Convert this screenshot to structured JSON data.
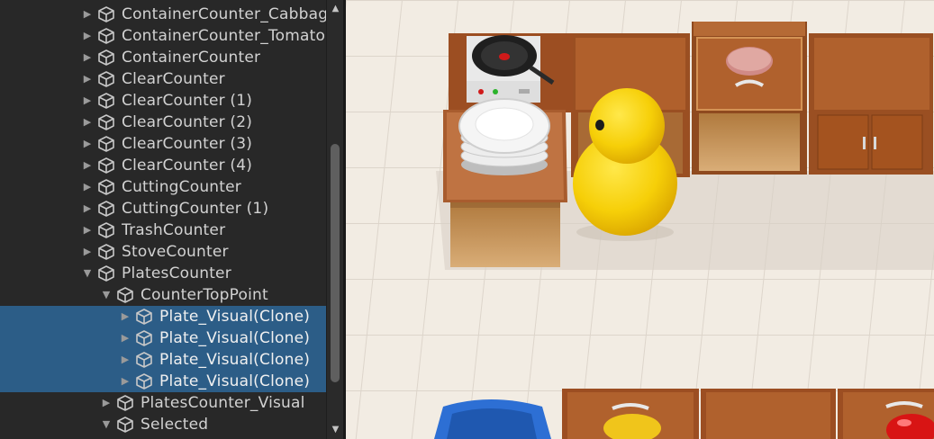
{
  "hierarchy": {
    "rows": [
      {
        "label": "ContainerCounter_Cabbage",
        "indent": 0,
        "expanded": false,
        "selected": false
      },
      {
        "label": "ContainerCounter_Tomato",
        "indent": 0,
        "expanded": false,
        "selected": false
      },
      {
        "label": "ContainerCounter",
        "indent": 0,
        "expanded": false,
        "selected": false
      },
      {
        "label": "ClearCounter",
        "indent": 0,
        "expanded": false,
        "selected": false
      },
      {
        "label": "ClearCounter (1)",
        "indent": 0,
        "expanded": false,
        "selected": false
      },
      {
        "label": "ClearCounter (2)",
        "indent": 0,
        "expanded": false,
        "selected": false
      },
      {
        "label": "ClearCounter (3)",
        "indent": 0,
        "expanded": false,
        "selected": false
      },
      {
        "label": "ClearCounter (4)",
        "indent": 0,
        "expanded": false,
        "selected": false
      },
      {
        "label": "CuttingCounter",
        "indent": 0,
        "expanded": false,
        "selected": false
      },
      {
        "label": "CuttingCounter (1)",
        "indent": 0,
        "expanded": false,
        "selected": false
      },
      {
        "label": "TrashCounter",
        "indent": 0,
        "expanded": false,
        "selected": false
      },
      {
        "label": "StoveCounter",
        "indent": 0,
        "expanded": false,
        "selected": false
      },
      {
        "label": "PlatesCounter",
        "indent": 0,
        "expanded": true,
        "selected": false
      },
      {
        "label": "CounterTopPoint",
        "indent": 1,
        "expanded": true,
        "selected": false
      },
      {
        "label": "Plate_Visual(Clone)",
        "indent": 2,
        "expanded": false,
        "selected": true
      },
      {
        "label": "Plate_Visual(Clone)",
        "indent": 2,
        "expanded": false,
        "selected": true
      },
      {
        "label": "Plate_Visual(Clone)",
        "indent": 2,
        "expanded": false,
        "selected": true
      },
      {
        "label": "Plate_Visual(Clone)",
        "indent": 2,
        "expanded": false,
        "selected": true
      },
      {
        "label": "PlatesCounter_Visual",
        "indent": 1,
        "expanded": false,
        "selected": false
      },
      {
        "label": "Selected",
        "indent": 1,
        "expanded": true,
        "selected": false
      }
    ]
  },
  "colors": {
    "panel_bg": "#282828",
    "selection": "#2c5d87",
    "text": "#d2d2d2",
    "floor": "#f2ece3",
    "counter_wood": "#a8582a",
    "player_yellow": "#f6cf08"
  },
  "icons": {
    "row_icon": "gameobject-cube-icon",
    "collapsed": "triangle-right-icon",
    "expanded": "triangle-down-icon",
    "scroll_up": "scroll-up-arrow-icon",
    "scroll_down": "scroll-down-arrow-icon"
  },
  "scene": {
    "objects": [
      "stove-counter",
      "plates-counter",
      "player-character",
      "clear-counter",
      "patty",
      "cabinet",
      "cutting-counter",
      "blue-bin",
      "tomato",
      "cabbage"
    ]
  }
}
